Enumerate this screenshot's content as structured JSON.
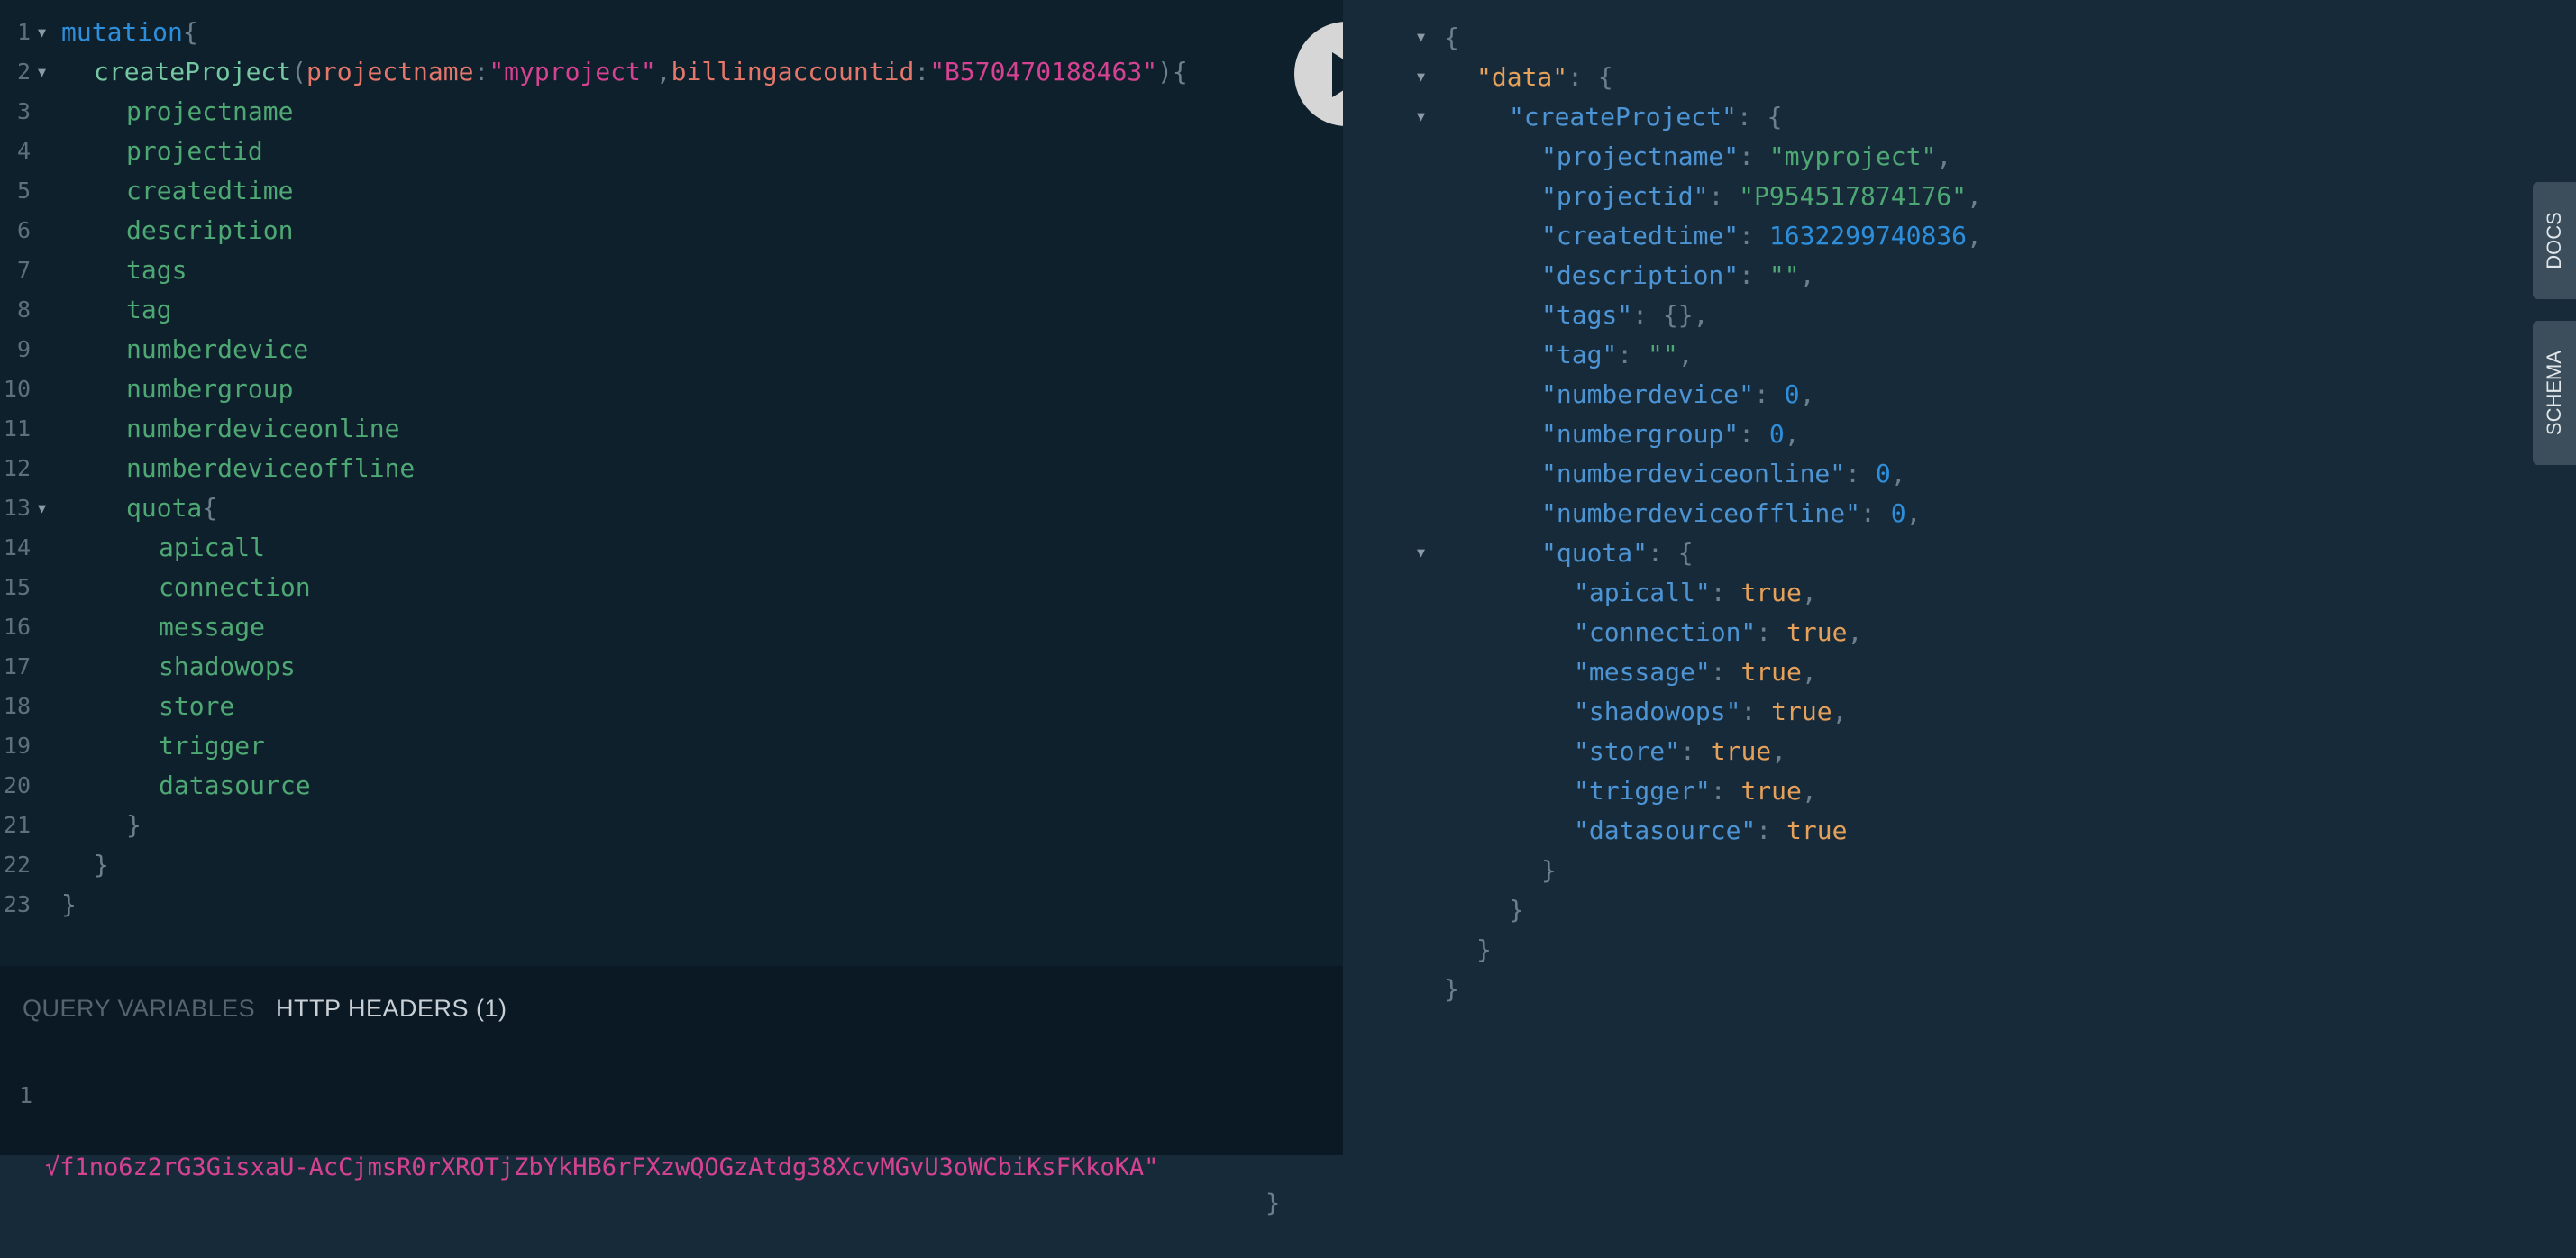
{
  "query": {
    "line_numbers": [
      "1",
      "2",
      "3",
      "4",
      "5",
      "6",
      "7",
      "8",
      "9",
      "10",
      "11",
      "12",
      "13",
      "14",
      "15",
      "16",
      "17",
      "18",
      "19",
      "20",
      "21",
      "22",
      "23"
    ],
    "mutation_keyword": "mutation",
    "open_brace": "{",
    "close_brace": "}",
    "create_fn": "createProject",
    "arg1_name": "projectname",
    "arg1_value": "\"myproject\"",
    "arg2_name": "billingaccountid",
    "arg2_value": "\"B570470188463\"",
    "fields": [
      "projectname",
      "projectid",
      "createdtime",
      "description",
      "tags",
      "tag",
      "numberdevice",
      "numbergroup",
      "numberdeviceonline",
      "numberdeviceoffline"
    ],
    "quota_field": "quota",
    "quota_fields": [
      "apicall",
      "connection",
      "message",
      "shadowops",
      "store",
      "trigger",
      "datasource"
    ]
  },
  "bottom_panel": {
    "tab_query_variables": "QUERY VARIABLES",
    "tab_http_headers": "HTTP HEADERS (1)",
    "line_number": "1",
    "header_value": "√f1no6z2rG3GisxaU-AcCjmsR0rXROTjZbYkHB6rFXzwQOGzAtdg38XcvMGvU3oWCbiKsFKkoKA\"",
    "header_close": "}"
  },
  "result": {
    "data_key": "\"data\"",
    "create_key": "\"createProject\"",
    "entries": [
      {
        "key": "\"projectname\"",
        "value": "\"myproject\"",
        "type": "s",
        "comma": ","
      },
      {
        "key": "\"projectid\"",
        "value": "\"P954517874176\"",
        "type": "s",
        "comma": ","
      },
      {
        "key": "\"createdtime\"",
        "value": "1632299740836",
        "type": "n",
        "comma": ","
      },
      {
        "key": "\"description\"",
        "value": "\"\"",
        "type": "s",
        "comma": ","
      },
      {
        "key": "\"tags\"",
        "value": "{}",
        "type": "p",
        "comma": ","
      },
      {
        "key": "\"tag\"",
        "value": "\"\"",
        "type": "s",
        "comma": ","
      },
      {
        "key": "\"numberdevice\"",
        "value": "0",
        "type": "n",
        "comma": ","
      },
      {
        "key": "\"numbergroup\"",
        "value": "0",
        "type": "n",
        "comma": ","
      },
      {
        "key": "\"numberdeviceonline\"",
        "value": "0",
        "type": "n",
        "comma": ","
      },
      {
        "key": "\"numberdeviceoffline\"",
        "value": "0",
        "type": "n",
        "comma": ","
      }
    ],
    "quota_key": "\"quota\"",
    "quota_entries": [
      {
        "key": "\"apicall\"",
        "value": "true",
        "comma": ","
      },
      {
        "key": "\"connection\"",
        "value": "true",
        "comma": ","
      },
      {
        "key": "\"message\"",
        "value": "true",
        "comma": ","
      },
      {
        "key": "\"shadowops\"",
        "value": "true",
        "comma": ","
      },
      {
        "key": "\"store\"",
        "value": "true",
        "comma": ","
      },
      {
        "key": "\"trigger\"",
        "value": "true",
        "comma": ","
      },
      {
        "key": "\"datasource\"",
        "value": "true",
        "comma": ""
      }
    ]
  },
  "side_tabs": {
    "docs": "DOCS",
    "schema": "SCHEMA"
  },
  "colors": {
    "editor_bg": "#0f202d",
    "result_bg": "#172a3a",
    "keyword": "#2d8fdb",
    "field": "#4ea873",
    "string": "#d64292",
    "argument": "#e4776a",
    "boolean": "#e5a05a"
  },
  "icons": {
    "run": "play-icon",
    "fold": "triangle-down-icon"
  }
}
